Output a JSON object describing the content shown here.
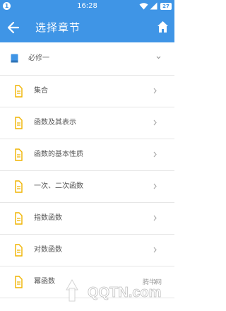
{
  "status_bar": {
    "notification_count": "1",
    "time": "16:28",
    "battery": "27"
  },
  "app_bar": {
    "title": "选择章节",
    "back_icon": "arrow-left-icon",
    "home_icon": "home-icon"
  },
  "chapter": {
    "label": "必修一",
    "icon": "book-icon",
    "expanded": true
  },
  "sections": [
    {
      "label": "集合"
    },
    {
      "label": "函数及其表示"
    },
    {
      "label": "函数的基本性质"
    },
    {
      "label": "一次、二次函数"
    },
    {
      "label": "指数函数"
    },
    {
      "label": "对数函数"
    },
    {
      "label": "幂函数"
    }
  ],
  "watermark": {
    "brand": "QQTN.com",
    "site": "腾牛网"
  },
  "colors": {
    "accent": "#3f95e6",
    "section_icon": "#f0b400"
  }
}
